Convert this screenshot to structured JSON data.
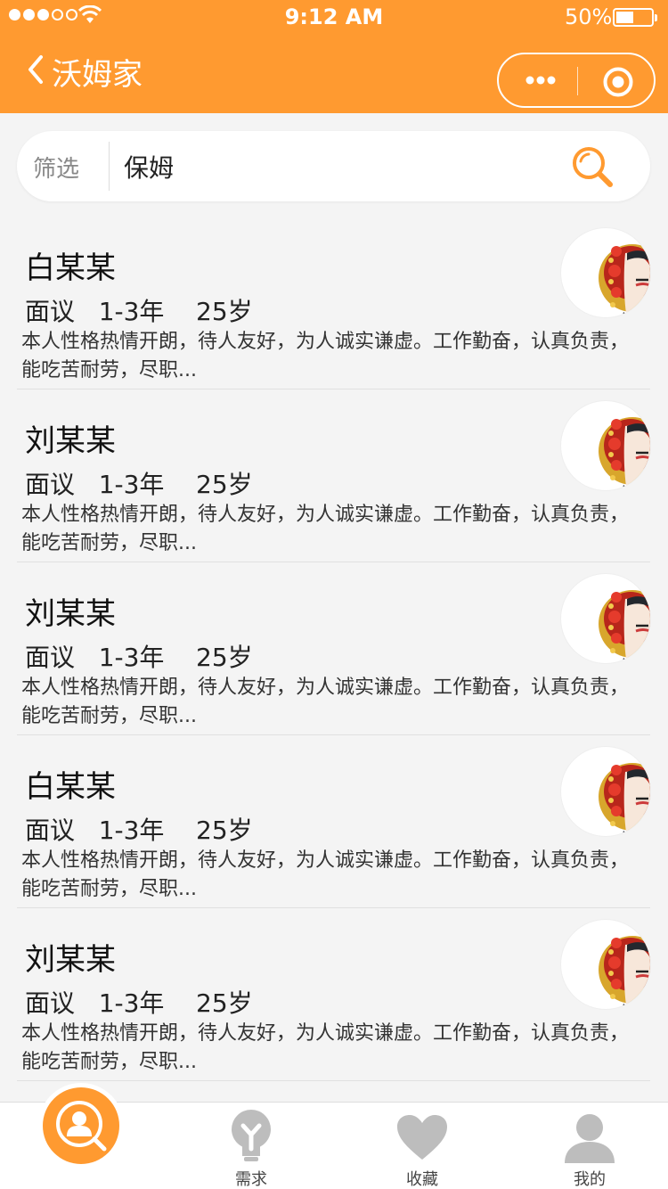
{
  "status_bar": {
    "time": "9:12 AM",
    "battery": "50%"
  },
  "nav": {
    "title": "沃姆家"
  },
  "search": {
    "filter_label": "筛选",
    "value": "保姆"
  },
  "workers": [
    {
      "name": "白某某",
      "meta": "面议   1-3年    25岁",
      "desc": "本人性格热情开朗，待人友好，为人诚实谦虚。工作勤奋，认真负责，能吃苦耐劳，尽职..."
    },
    {
      "name": "刘某某",
      "meta": "面议   1-3年    25岁",
      "desc": "本人性格热情开朗，待人友好，为人诚实谦虚。工作勤奋，认真负责，能吃苦耐劳，尽职..."
    },
    {
      "name": "刘某某",
      "meta": "面议   1-3年    25岁",
      "desc": "本人性格热情开朗，待人友好，为人诚实谦虚。工作勤奋，认真负责，能吃苦耐劳，尽职..."
    },
    {
      "name": "白某某",
      "meta": "面议   1-3年    25岁",
      "desc": "本人性格热情开朗，待人友好，为人诚实谦虚。工作勤奋，认真负责，能吃苦耐劳，尽职..."
    },
    {
      "name": "刘某某",
      "meta": "面议   1-3年    25岁",
      "desc": "本人性格热情开朗，待人友好，为人诚实谦虚。工作勤奋，认真负责，能吃苦耐劳，尽职..."
    }
  ],
  "tabs": [
    {
      "icon": "person-search-icon",
      "label": ""
    },
    {
      "icon": "lightbulb-icon",
      "label": "需求"
    },
    {
      "icon": "heart-icon",
      "label": "收藏"
    },
    {
      "icon": "user-icon",
      "label": "我的"
    }
  ],
  "colors": {
    "brand": "#ff9a30",
    "background": "#f4f4f4",
    "tab_icon": "#bdbdbd"
  }
}
